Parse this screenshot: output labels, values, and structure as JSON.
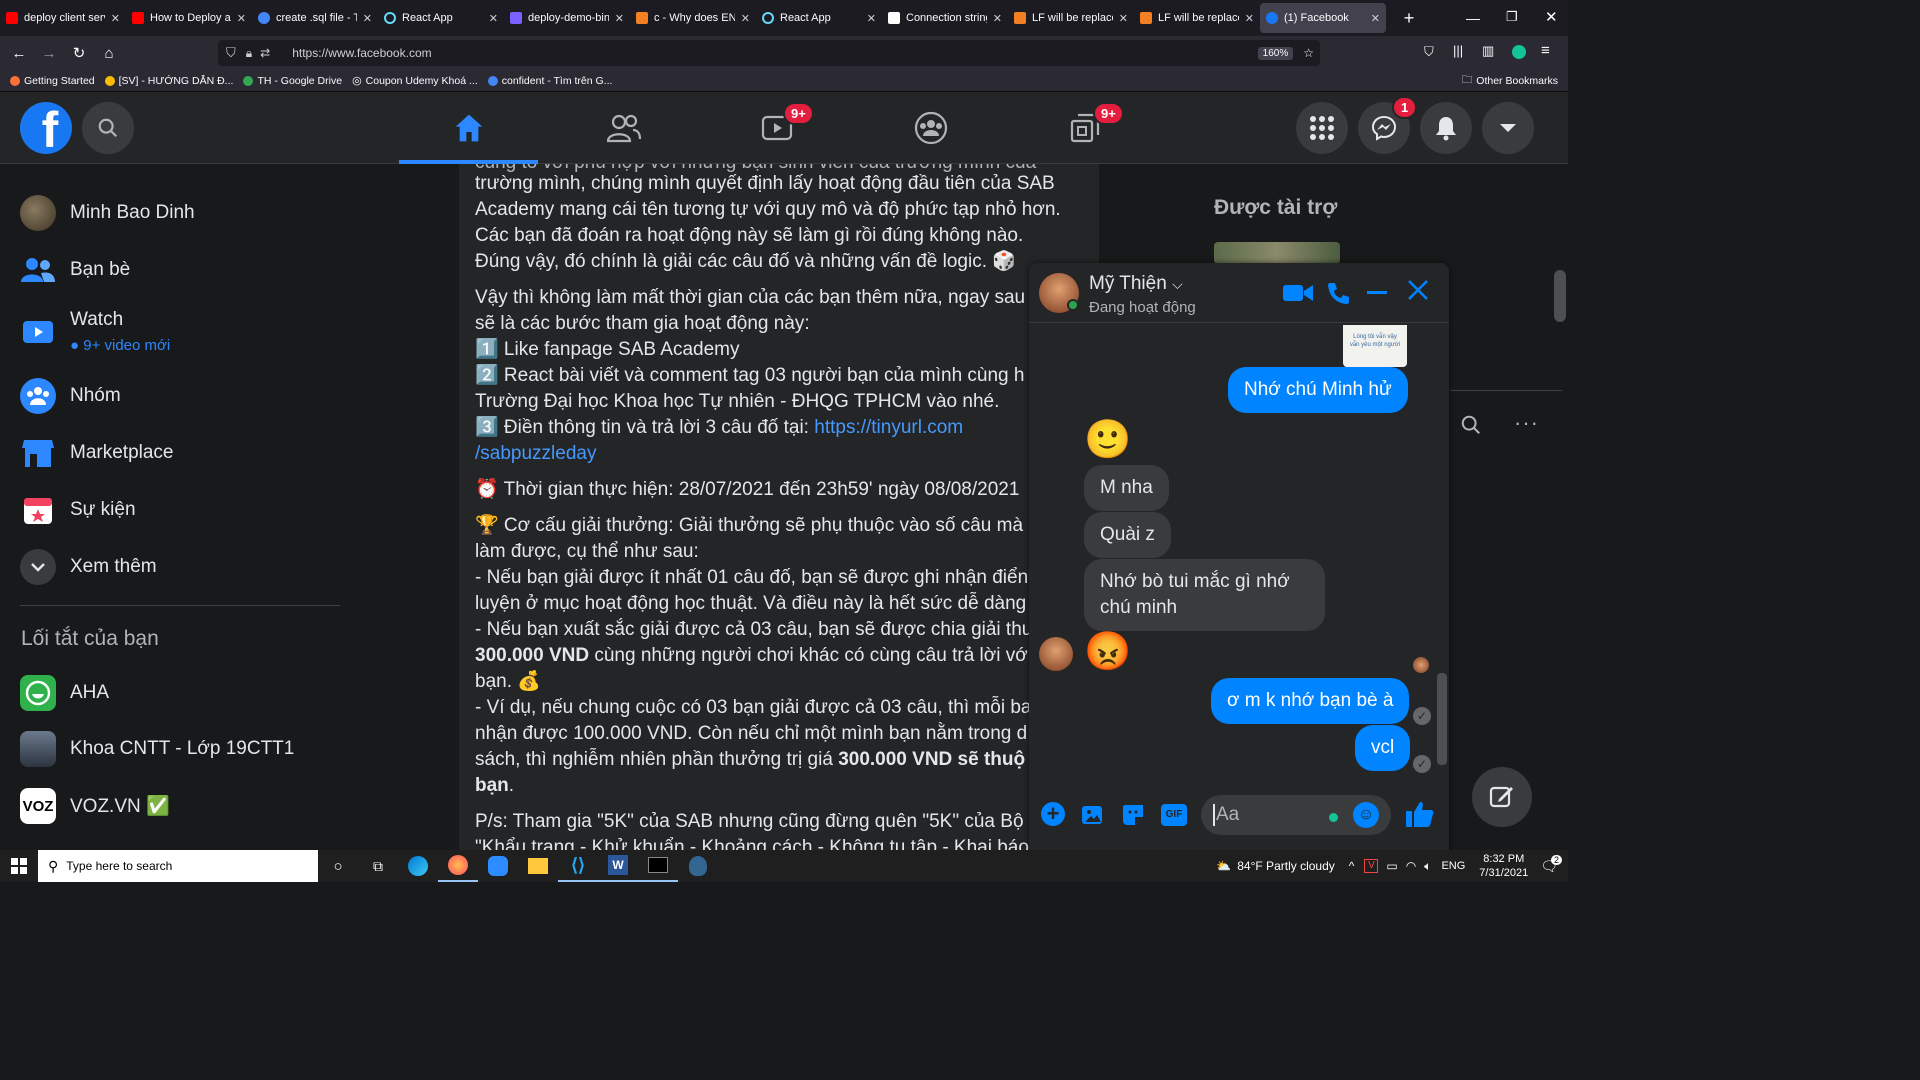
{
  "browser": {
    "tabs": [
      {
        "title": "deploy client serve",
        "color": "#ff0000"
      },
      {
        "title": "How to Deploy a R",
        "color": "#ff0000"
      },
      {
        "title": "create .sql file - Tr",
        "color": "#4285f4"
      },
      {
        "title": "React App",
        "color": "#61dafb"
      },
      {
        "title": "deploy-demo-bin",
        "color": "#7b61ff"
      },
      {
        "title": "c - Why does ENO",
        "color": "#f48024"
      },
      {
        "title": "React App",
        "color": "#61dafb"
      },
      {
        "title": "Connection string",
        "color": "#ffffff"
      },
      {
        "title": "LF will be replaced",
        "color": "#f48024"
      },
      {
        "title": "LF will be replaced",
        "color": "#f48024"
      },
      {
        "title": "(1) Facebook",
        "color": "#1877f2"
      }
    ],
    "url": "https://www.facebook.com",
    "zoom": "160%",
    "bookmarks": [
      "Getting Started",
      "[SV] - HƯỚNG DẪN Đ...",
      "TH - Google Drive",
      "Coupon Udemy Khoá ...",
      "confident - Tìm trên G..."
    ],
    "other_bookmarks": "Other Bookmarks"
  },
  "fb": {
    "badges": {
      "watch": "9+",
      "gaming": "9+",
      "messenger": "1"
    },
    "sidebar": {
      "user": "Minh Bao Dinh",
      "friends": "Bạn bè",
      "watch": "Watch",
      "watch_sub": "9+ video mới",
      "groups": "Nhóm",
      "marketplace": "Marketplace",
      "events": "Sự kiện",
      "more": "Xem thêm",
      "shortcuts_title": "Lối tắt của bạn",
      "shortcuts": [
        "AHA",
        "Khoa CNTT - Lớp 19CTT1",
        "VOZ.VN ✅"
      ]
    },
    "post": {
      "lines": [
        "trường mình, chúng mình quyết định lấy hoạt động đầu tiên của SAB",
        "Academy mang cái tên tương tự với quy mô và độ phức tạp nhỏ hơn.",
        "Các bạn đã đoán ra hoạt động này sẽ làm gì rồi đúng không nào.",
        "Đúng vậy, đó chính là giải các câu đố và những vấn đề logic. 🎲",
        "Vậy thì không làm mất thời gian của các bạn thêm nữa, ngay sau",
        "sẽ là các bước tham gia hoạt động này:",
        "1️⃣ Like fanpage SAB Academy",
        "2️⃣ React bài viết và comment tag 03 người bạn của mình cùng h",
        "Trường Đại học Khoa học Tự nhiên - ĐHQG TPHCM vào nhé.",
        "3️⃣ Điền thông tin và trả lời 3 câu đố tại: ",
        "/sabpuzzleday",
        "⏰ Thời gian thực hiện: 28/07/2021 đến 23h59' ngày 08/08/2021",
        "🏆 Cơ cấu giải thưởng: Giải thưởng sẽ phụ thuộc vào số câu mà b",
        "làm được, cụ thể như sau:",
        "- Nếu bạn giải được ít nhất 01 câu đố, bạn sẽ được ghi nhận điển",
        "luyện ở mục hoạt động học thuật. Và điều này là hết sức dễ dàng",
        "- Nếu bạn xuất sắc giải được cả 03 câu, bạn sẽ được chia giải thư",
        "300.000 VND",
        " cùng những người chơi khác có cùng câu trả lời vớ",
        "bạn. 💰",
        "- Ví dụ, nếu chung cuộc có 03 bạn giải được cả 03 câu, thì mỗi ba",
        "nhận được 100.000 VND. Còn nếu chỉ một mình bạn nằm trong d",
        "sách, thì nghiễm nhiên phần thưởng trị giá ",
        "300.000 VND sẽ thuộ",
        "bạn",
        ".",
        "P/s: Tham gia \"5K\" của SAB nhưng cũng đừng quên \"5K\" của Bộ Y",
        "\"Khẩu trang - Khử khuẩn - Khoảng cách - Không tụ tập - Khai báo"
      ],
      "link1": "https://tinyurl.com",
      "top_partial": "cùng tổ với phù hợp với những bạn sinh viên của trường mình của"
    },
    "right": {
      "sponsored": "Được tài trợ"
    },
    "chat": {
      "name": "Mỹ Thiện",
      "status": "Đang hoạt động",
      "sticker_text": "Lòng tôi vẫn vậy\nvẫn yêu một người",
      "messages": [
        {
          "from": "me",
          "text": "Nhớ chú Minh hử"
        },
        {
          "from": "them",
          "text": "🙂"
        },
        {
          "from": "them",
          "text": "M nha"
        },
        {
          "from": "them",
          "text": "Quài z"
        },
        {
          "from": "them",
          "text": "Nhớ bò tui mắc gì nhớ\nchú minh"
        },
        {
          "from": "them",
          "text": "😡"
        },
        {
          "from": "me",
          "text": "ơ m k nhớ bạn bè à"
        },
        {
          "from": "me",
          "text": "vcl"
        }
      ],
      "input_placeholder": "Aa"
    }
  },
  "taskbar": {
    "search_placeholder": "Type here to search",
    "weather": "84°F  Partly cloudy",
    "lang": "ENG",
    "time": "8:32 PM",
    "date": "7/31/2021",
    "notif": "2"
  },
  "colors": {
    "fb_blue": "#1877f2",
    "messenger_blue": "#0084ff",
    "bg": "#18191a",
    "card": "#242526"
  }
}
